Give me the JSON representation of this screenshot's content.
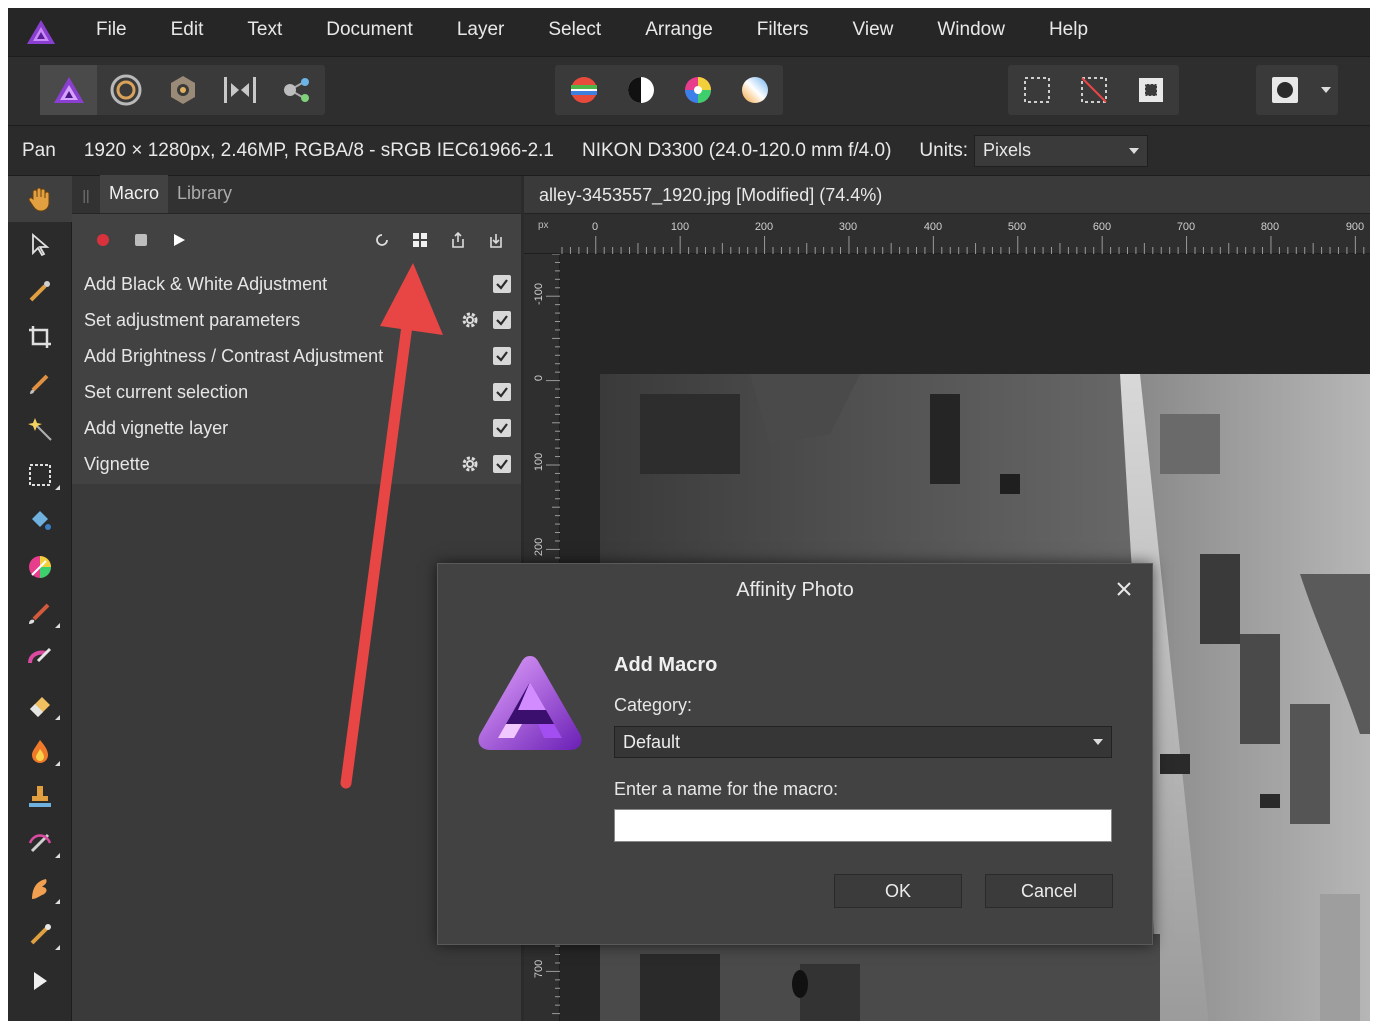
{
  "app": {
    "menu": [
      "File",
      "Edit",
      "Text",
      "Document",
      "Layer",
      "Select",
      "Arrange",
      "Filters",
      "View",
      "Window",
      "Help"
    ]
  },
  "context_bar": {
    "tool": "Pan",
    "doc_info": "1920 × 1280px, 2.46MP, RGBA/8 - sRGB IEC61966-2.1",
    "camera": "NIKON D3300 (24.0-120.0 mm f/4.0)",
    "units_label": "Units:",
    "units_value": "Pixels"
  },
  "panel": {
    "tabs": [
      {
        "label": "Macro",
        "active": true
      },
      {
        "label": "Library",
        "active": false
      }
    ],
    "macro_steps": [
      {
        "label": "Add Black & White Adjustment",
        "has_settings": false,
        "checked": true
      },
      {
        "label": "Set adjustment parameters",
        "has_settings": true,
        "checked": true
      },
      {
        "label": "Add Brightness / Contrast Adjustment",
        "has_settings": false,
        "checked": true
      },
      {
        "label": "Set current selection",
        "has_settings": false,
        "checked": true
      },
      {
        "label": "Add vignette layer",
        "has_settings": false,
        "checked": true
      },
      {
        "label": "Vignette",
        "has_settings": true,
        "checked": true
      }
    ]
  },
  "document": {
    "tab_title": "alley-3453557_1920.jpg [Modified] (74.4%)",
    "ruler_unit": "px",
    "ruler_h_labels": [
      "0",
      "100",
      "200",
      "300",
      "400",
      "500",
      "600",
      "700",
      "800",
      "900"
    ],
    "ruler_v_labels": [
      "-100",
      "0",
      "100",
      "200",
      "700"
    ]
  },
  "dialog": {
    "title": "Affinity Photo",
    "heading": "Add Macro",
    "category_label": "Category:",
    "category_value": "Default",
    "name_label": "Enter a name for the macro:",
    "name_value": "",
    "ok_label": "OK",
    "cancel_label": "Cancel"
  },
  "colors": {
    "accent_purple": "#8a3fd1",
    "annotation_red": "#e84545",
    "record_red": "#d9323c"
  },
  "icons": {
    "toolbar_personas": [
      "photo-persona-icon",
      "liquify-persona-icon",
      "develop-persona-icon",
      "tone-mapping-persona-icon",
      "export-persona-icon"
    ],
    "toolbar_adjust": [
      "auto-levels-icon",
      "auto-contrast-icon",
      "auto-colors-icon",
      "auto-white-balance-icon"
    ],
    "toolbar_selection": [
      "marquee-selection-icon",
      "deselect-icon",
      "invert-selection-icon"
    ],
    "macro_toolbar": [
      "record-icon",
      "stop-icon",
      "play-icon",
      "clear-icon",
      "add-to-library-icon",
      "export-icon",
      "import-icon"
    ]
  }
}
